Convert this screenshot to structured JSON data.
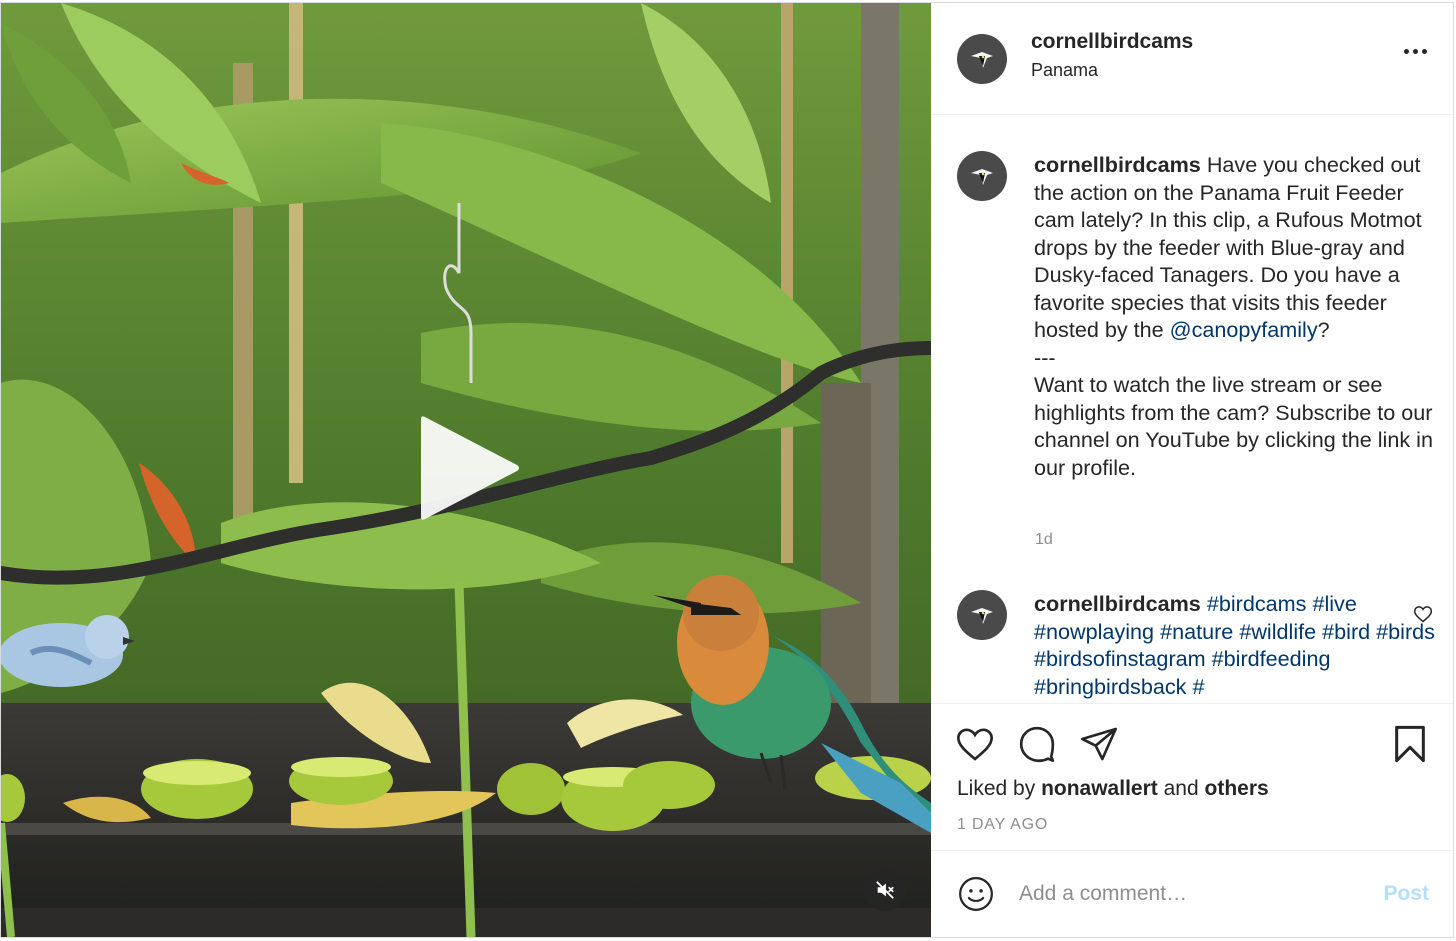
{
  "post": {
    "username": "cornellbirdcams",
    "location": "Panama"
  },
  "caption": {
    "username": "cornellbirdcams",
    "text_before_mention": "Have you checked out the action on the Panama Fruit Feeder cam lately? In this clip, a Rufous Motmot drops by the feeder with Blue-gray and Dusky-faced Tanagers. Do you have a favorite species that visits this feeder hosted by the ",
    "mention": "@canopyfamily",
    "text_after_mention": "?",
    "separator": "---",
    "text_2": "Want to watch the live stream or see highlights from the cam? Subscribe to our channel on YouTube by clicking the link in our profile.",
    "timestamp": "1d"
  },
  "comment": {
    "username": "cornellbirdcams",
    "hashtags": [
      "#birdcams",
      "#live",
      "#nowplaying",
      "#nature",
      "#wildlife",
      "#bird",
      "#birds",
      "#birdsofinstagram",
      "#birdfeeding",
      "#bringbirdsback",
      "#"
    ]
  },
  "likes": {
    "prefix": "Liked by",
    "user": "nonawallert",
    "and": "and",
    "others": "others"
  },
  "time_ago": "1 DAY AGO",
  "comment_box": {
    "placeholder": "Add a comment…",
    "post_label": "Post"
  },
  "icons": {
    "more": "more-options-icon",
    "like": "heart-icon",
    "comment": "comment-icon",
    "share": "paper-plane-icon",
    "save": "bookmark-icon",
    "emoji": "emoji-icon",
    "play": "play-icon",
    "mute": "muted-speaker-icon"
  },
  "colors": {
    "link": "#00376b",
    "post_disabled": "#b2dffc",
    "secondary_text": "#8e8e8e"
  }
}
